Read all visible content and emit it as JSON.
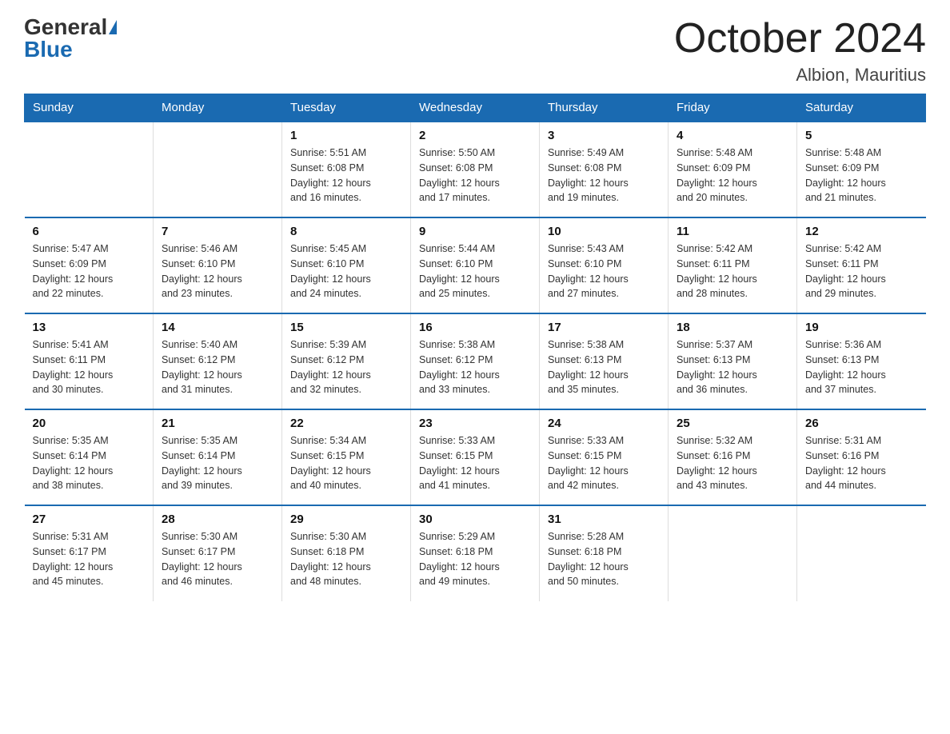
{
  "logo": {
    "general": "General",
    "blue": "Blue"
  },
  "header": {
    "month": "October 2024",
    "location": "Albion, Mauritius"
  },
  "days_of_week": [
    "Sunday",
    "Monday",
    "Tuesday",
    "Wednesday",
    "Thursday",
    "Friday",
    "Saturday"
  ],
  "weeks": [
    [
      {
        "day": "",
        "info": ""
      },
      {
        "day": "",
        "info": ""
      },
      {
        "day": "1",
        "info": "Sunrise: 5:51 AM\nSunset: 6:08 PM\nDaylight: 12 hours\nand 16 minutes."
      },
      {
        "day": "2",
        "info": "Sunrise: 5:50 AM\nSunset: 6:08 PM\nDaylight: 12 hours\nand 17 minutes."
      },
      {
        "day": "3",
        "info": "Sunrise: 5:49 AM\nSunset: 6:08 PM\nDaylight: 12 hours\nand 19 minutes."
      },
      {
        "day": "4",
        "info": "Sunrise: 5:48 AM\nSunset: 6:09 PM\nDaylight: 12 hours\nand 20 minutes."
      },
      {
        "day": "5",
        "info": "Sunrise: 5:48 AM\nSunset: 6:09 PM\nDaylight: 12 hours\nand 21 minutes."
      }
    ],
    [
      {
        "day": "6",
        "info": "Sunrise: 5:47 AM\nSunset: 6:09 PM\nDaylight: 12 hours\nand 22 minutes."
      },
      {
        "day": "7",
        "info": "Sunrise: 5:46 AM\nSunset: 6:10 PM\nDaylight: 12 hours\nand 23 minutes."
      },
      {
        "day": "8",
        "info": "Sunrise: 5:45 AM\nSunset: 6:10 PM\nDaylight: 12 hours\nand 24 minutes."
      },
      {
        "day": "9",
        "info": "Sunrise: 5:44 AM\nSunset: 6:10 PM\nDaylight: 12 hours\nand 25 minutes."
      },
      {
        "day": "10",
        "info": "Sunrise: 5:43 AM\nSunset: 6:10 PM\nDaylight: 12 hours\nand 27 minutes."
      },
      {
        "day": "11",
        "info": "Sunrise: 5:42 AM\nSunset: 6:11 PM\nDaylight: 12 hours\nand 28 minutes."
      },
      {
        "day": "12",
        "info": "Sunrise: 5:42 AM\nSunset: 6:11 PM\nDaylight: 12 hours\nand 29 minutes."
      }
    ],
    [
      {
        "day": "13",
        "info": "Sunrise: 5:41 AM\nSunset: 6:11 PM\nDaylight: 12 hours\nand 30 minutes."
      },
      {
        "day": "14",
        "info": "Sunrise: 5:40 AM\nSunset: 6:12 PM\nDaylight: 12 hours\nand 31 minutes."
      },
      {
        "day": "15",
        "info": "Sunrise: 5:39 AM\nSunset: 6:12 PM\nDaylight: 12 hours\nand 32 minutes."
      },
      {
        "day": "16",
        "info": "Sunrise: 5:38 AM\nSunset: 6:12 PM\nDaylight: 12 hours\nand 33 minutes."
      },
      {
        "day": "17",
        "info": "Sunrise: 5:38 AM\nSunset: 6:13 PM\nDaylight: 12 hours\nand 35 minutes."
      },
      {
        "day": "18",
        "info": "Sunrise: 5:37 AM\nSunset: 6:13 PM\nDaylight: 12 hours\nand 36 minutes."
      },
      {
        "day": "19",
        "info": "Sunrise: 5:36 AM\nSunset: 6:13 PM\nDaylight: 12 hours\nand 37 minutes."
      }
    ],
    [
      {
        "day": "20",
        "info": "Sunrise: 5:35 AM\nSunset: 6:14 PM\nDaylight: 12 hours\nand 38 minutes."
      },
      {
        "day": "21",
        "info": "Sunrise: 5:35 AM\nSunset: 6:14 PM\nDaylight: 12 hours\nand 39 minutes."
      },
      {
        "day": "22",
        "info": "Sunrise: 5:34 AM\nSunset: 6:15 PM\nDaylight: 12 hours\nand 40 minutes."
      },
      {
        "day": "23",
        "info": "Sunrise: 5:33 AM\nSunset: 6:15 PM\nDaylight: 12 hours\nand 41 minutes."
      },
      {
        "day": "24",
        "info": "Sunrise: 5:33 AM\nSunset: 6:15 PM\nDaylight: 12 hours\nand 42 minutes."
      },
      {
        "day": "25",
        "info": "Sunrise: 5:32 AM\nSunset: 6:16 PM\nDaylight: 12 hours\nand 43 minutes."
      },
      {
        "day": "26",
        "info": "Sunrise: 5:31 AM\nSunset: 6:16 PM\nDaylight: 12 hours\nand 44 minutes."
      }
    ],
    [
      {
        "day": "27",
        "info": "Sunrise: 5:31 AM\nSunset: 6:17 PM\nDaylight: 12 hours\nand 45 minutes."
      },
      {
        "day": "28",
        "info": "Sunrise: 5:30 AM\nSunset: 6:17 PM\nDaylight: 12 hours\nand 46 minutes."
      },
      {
        "day": "29",
        "info": "Sunrise: 5:30 AM\nSunset: 6:18 PM\nDaylight: 12 hours\nand 48 minutes."
      },
      {
        "day": "30",
        "info": "Sunrise: 5:29 AM\nSunset: 6:18 PM\nDaylight: 12 hours\nand 49 minutes."
      },
      {
        "day": "31",
        "info": "Sunrise: 5:28 AM\nSunset: 6:18 PM\nDaylight: 12 hours\nand 50 minutes."
      },
      {
        "day": "",
        "info": ""
      },
      {
        "day": "",
        "info": ""
      }
    ]
  ]
}
